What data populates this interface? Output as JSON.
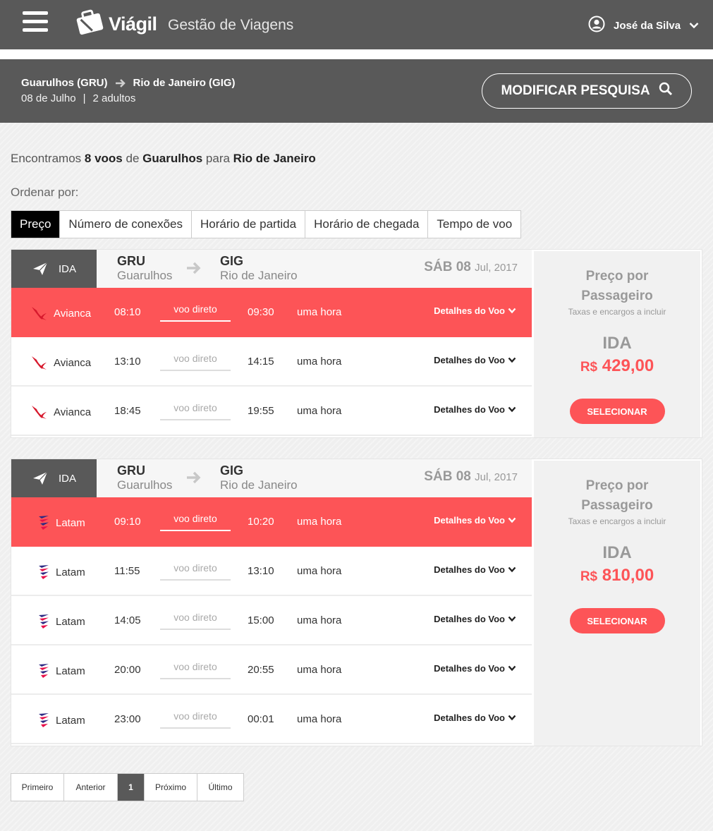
{
  "header": {
    "brand": "Viágil",
    "subtitle": "Gestão de Viagens",
    "user_name": "José da Silva"
  },
  "search": {
    "origin": "Guarulhos (GRU)",
    "destination": "Rio de Janeiro (GIG)",
    "date": "08 de Julho",
    "separator": "|",
    "passengers": "2 adultos",
    "modify_label": "MODIFICAR PESQUISA"
  },
  "results": {
    "prefix": "Encontramos",
    "count": "8 voos",
    "from_word": "de",
    "from_city": "Guarulhos",
    "to_word": "para",
    "to_city": "Rio de Janeiro"
  },
  "sort": {
    "label": "Ordenar por:",
    "options": [
      "Preço",
      "Número de conexões",
      "Horário de partida",
      "Horário de chegada",
      "Tempo de voo"
    ],
    "active": "Preço"
  },
  "groups": [
    {
      "leg": "IDA",
      "from_code": "GRU",
      "from_city": "Guarulhos",
      "to_code": "GIG",
      "to_city": "Rio de Janeiro",
      "date_day": "SÁB 08",
      "date_rest": "Jul, 2017",
      "price_title_1": "Preço por",
      "price_title_2": "Passageiro",
      "taxes_note": "Taxas e encargos a incluir",
      "price_leg": "IDA",
      "currency": "R$",
      "price": "429,00",
      "select_label": "SELECIONAR",
      "flights": [
        {
          "airline": "Avianca",
          "dep": "08:10",
          "stops": "voo direto",
          "arr": "09:30",
          "duration": "uma hora",
          "details": "Detalhes do Voo",
          "selected": true
        },
        {
          "airline": "Avianca",
          "dep": "13:10",
          "stops": "voo direto",
          "arr": "14:15",
          "duration": "uma hora",
          "details": "Detalhes do Voo",
          "selected": false
        },
        {
          "airline": "Avianca",
          "dep": "18:45",
          "stops": "voo direto",
          "arr": "19:55",
          "duration": "uma hora",
          "details": "Detalhes do Voo",
          "selected": false
        }
      ]
    },
    {
      "leg": "IDA",
      "from_code": "GRU",
      "from_city": "Guarulhos",
      "to_code": "GIG",
      "to_city": "Rio de Janeiro",
      "date_day": "SÁB 08",
      "date_rest": "Jul, 2017",
      "price_title_1": "Preço por",
      "price_title_2": "Passageiro",
      "taxes_note": "Taxas e encargos a incluir",
      "price_leg": "IDA",
      "currency": "R$",
      "price": "810,00",
      "select_label": "SELECIONAR",
      "flights": [
        {
          "airline": "Latam",
          "dep": "09:10",
          "stops": "voo direto",
          "arr": "10:20",
          "duration": "uma hora",
          "details": "Detalhes do Voo",
          "selected": true
        },
        {
          "airline": "Latam",
          "dep": "11:55",
          "stops": "voo direto",
          "arr": "13:10",
          "duration": "uma hora",
          "details": "Detalhes do Voo",
          "selected": false
        },
        {
          "airline": "Latam",
          "dep": "14:05",
          "stops": "voo direto",
          "arr": "15:00",
          "duration": "uma hora",
          "details": "Detalhes do Voo",
          "selected": false
        },
        {
          "airline": "Latam",
          "dep": "20:00",
          "stops": "voo direto",
          "arr": "20:55",
          "duration": "uma hora",
          "details": "Detalhes do Voo",
          "selected": false
        },
        {
          "airline": "Latam",
          "dep": "23:00",
          "stops": "voo direto",
          "arr": "00:01",
          "duration": "uma hora",
          "details": "Detalhes do Voo",
          "selected": false
        }
      ]
    }
  ],
  "pagination": {
    "first": "Primeiro",
    "prev": "Anterior",
    "current": "1",
    "next": "Próximo",
    "last": "Último"
  },
  "colors": {
    "accent": "#fd5457",
    "header_bg": "#595959",
    "avianca_red": "#d7192d",
    "latam_blue": "#2d2a83",
    "latam_red": "#e8114b"
  },
  "icons": {
    "menu": "hamburger-menu-icon",
    "logo": "suitcase-logo-icon",
    "user": "user-avatar-icon",
    "dropdown": "chevron-down-icon",
    "route_arrow": "arrow-right-icon",
    "search": "search-icon",
    "plane": "plane-icon",
    "avianca": "avianca-logo-icon",
    "latam": "latam-logo-icon"
  }
}
